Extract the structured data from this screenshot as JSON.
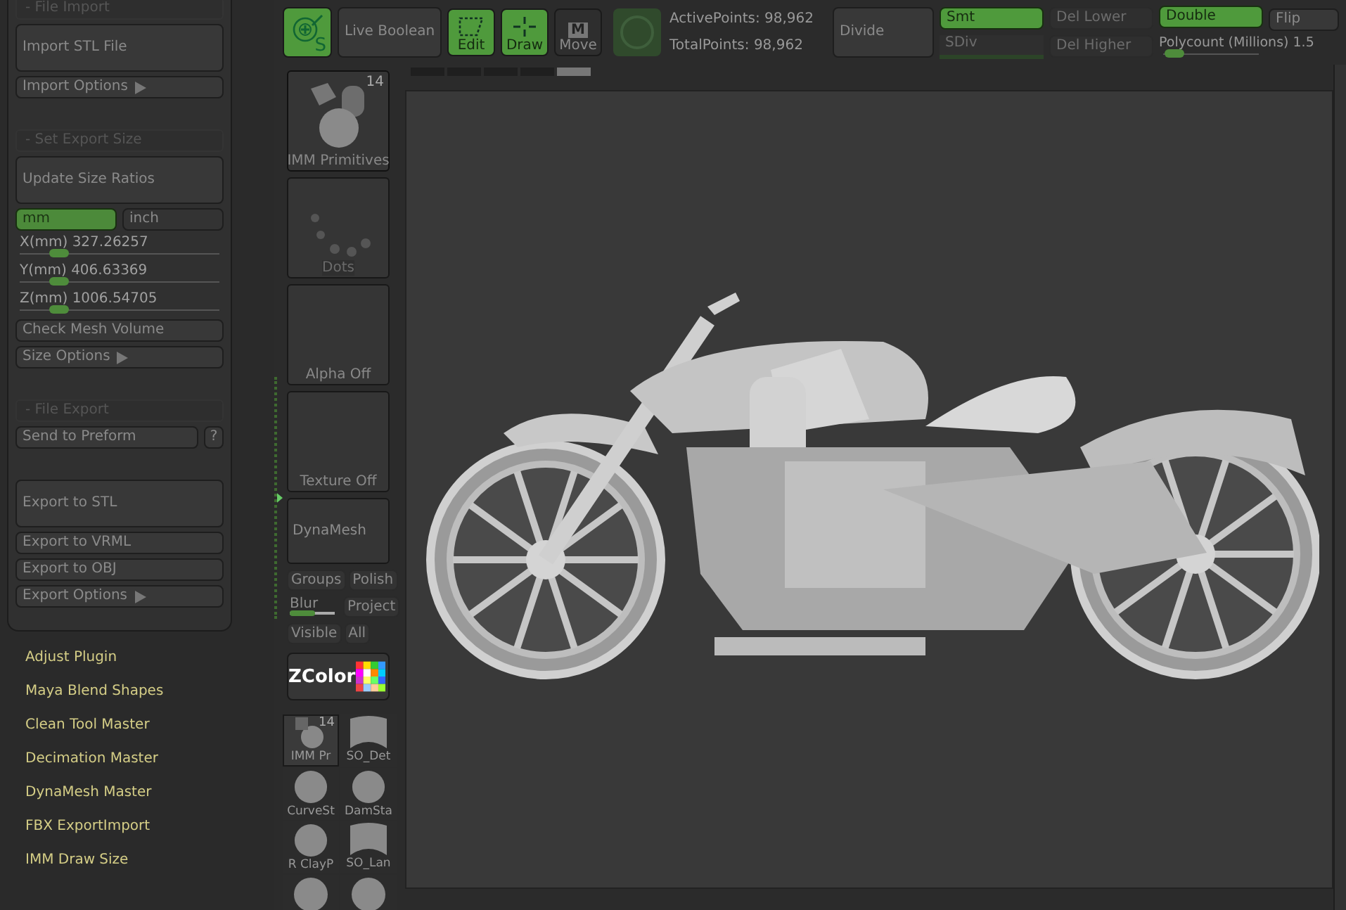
{
  "plugin_panel": {
    "items": [
      {
        "kind": "header",
        "label": "- File Import"
      },
      {
        "kind": "tall",
        "label": "Import STL File"
      },
      {
        "kind": "menu",
        "label": "Import Options"
      },
      {
        "kind": "header",
        "label": "- Set Export Size"
      },
      {
        "kind": "tall",
        "label": "Update Size Ratios"
      },
      {
        "kind": "units",
        "options": [
          {
            "label": "mm",
            "selected": true
          },
          {
            "label": "inch",
            "selected": false
          }
        ]
      },
      {
        "kind": "slider",
        "label": "X(mm) 327.26257",
        "level": 0.2
      },
      {
        "kind": "slider",
        "label": "Y(mm) 406.63369",
        "level": 0.2
      },
      {
        "kind": "slider",
        "label": "Z(mm) 1006.54705",
        "level": 0.2
      },
      {
        "kind": "button",
        "label": "Check Mesh Volume"
      },
      {
        "kind": "menu",
        "label": "Size Options"
      },
      {
        "kind": "header",
        "label": "- File Export"
      },
      {
        "kind": "help",
        "label": "Send to Preform",
        "help": "?"
      },
      {
        "kind": "tall",
        "label": "Export to STL"
      },
      {
        "kind": "button",
        "label": "Export to VRML"
      },
      {
        "kind": "button",
        "label": "Export to OBJ"
      },
      {
        "kind": "menu",
        "label": "Export Options"
      }
    ]
  },
  "plugins": [
    "Adjust Plugin",
    "Maya Blend Shapes",
    "Clean Tool Master",
    "Decimation Master",
    "DynaMesh Master",
    "FBX ExportImport",
    "IMM Draw Size"
  ],
  "toolbar": {
    "simple": {
      "letter": "S",
      "selected": true
    },
    "live_boolean": {
      "label": "Live Boolean",
      "on": false
    },
    "modes": [
      {
        "kind": "edit",
        "label": "Edit",
        "selected": true
      },
      {
        "kind": "draw",
        "label": "Draw",
        "selected": true
      },
      {
        "kind": "move",
        "label": "Move",
        "badge": "M",
        "selected": false
      }
    ],
    "stats": [
      "ActivePoints: 98,962",
      "TotalPoints: 98,962"
    ],
    "divide": "Divide",
    "smt": {
      "label": "Smt",
      "on": true
    },
    "sdiv": {
      "label": "SDiv",
      "disabled": true
    },
    "del_lower": {
      "label": "Del Lower",
      "disabled": true
    },
    "del_higher": {
      "label": "Del Higher",
      "disabled": true
    },
    "double": {
      "label": "Double",
      "on": true
    },
    "flip": {
      "label": "Flip",
      "on": false
    },
    "polycount": {
      "label": "Polycount (Millions) 1.5",
      "level": 0.12
    }
  },
  "tool_column": {
    "tiles": [
      {
        "kind": "imm",
        "label": "IMM Primitives",
        "badge": "14",
        "disabled": false
      },
      {
        "kind": "dots",
        "label": "Dots",
        "disabled": true
      },
      {
        "kind": "blank",
        "label": "Alpha Off",
        "disabled": false
      },
      {
        "kind": "blank",
        "label": "Texture Off",
        "disabled": false
      }
    ],
    "dynamesh": "DynaMesh",
    "pairs": [
      [
        {
          "label": "Groups"
        },
        {
          "label": "Polish"
        }
      ],
      [
        {
          "label": "Blur",
          "level": 0.55
        },
        {
          "label": "Project"
        }
      ],
      [
        {
          "label": "Visible"
        },
        {
          "label": "All"
        }
      ]
    ],
    "zcolor": "ZColor",
    "brushes": [
      {
        "kind": "imm",
        "label": "IMM Pr",
        "badge": "14",
        "selected": true
      },
      {
        "kind": "slab",
        "label": "SO_Det",
        "selected": false
      },
      {
        "kind": "ball",
        "label": "CurveSt",
        "selected": false
      },
      {
        "kind": "ball",
        "label": "DamSta",
        "selected": false
      },
      {
        "kind": "ball",
        "label": "R ClayP",
        "selected": false
      },
      {
        "kind": "slab",
        "label": "SO_Lan",
        "selected": false
      },
      {
        "kind": "ball",
        "selected": false
      },
      {
        "kind": "ball",
        "selected": false
      }
    ]
  },
  "canvas": {
    "tabs": [
      {
        "selected": false
      },
      {
        "selected": false
      },
      {
        "selected": false
      },
      {
        "selected": false
      },
      {
        "selected": true
      }
    ]
  }
}
